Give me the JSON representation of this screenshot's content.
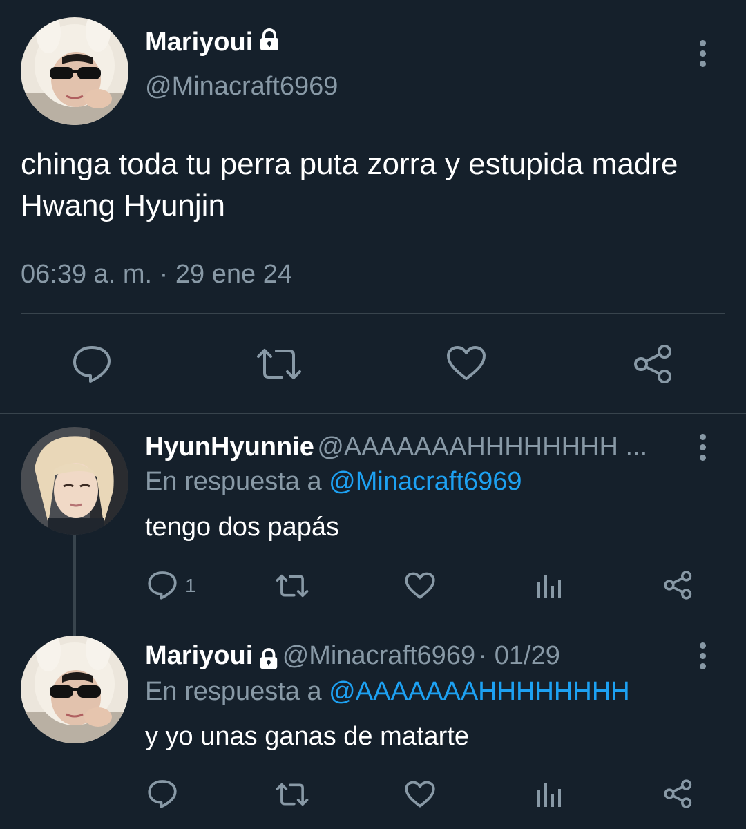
{
  "colors": {
    "background": "#15202b",
    "text_primary": "#ffffff",
    "text_secondary": "#8899a6",
    "link": "#1da1f2",
    "divider": "#38444d"
  },
  "main_tweet": {
    "author_name": "Mariyoui",
    "author_handle": "@Minacraft6969",
    "text": "chinga toda tu perra puta zorra y estupida madre Hwang Hyunjin",
    "time": "06:39 a. m.",
    "date": "29 ene 24",
    "icons": [
      "reply-icon",
      "retweet-icon",
      "like-icon",
      "share-icon"
    ]
  },
  "replies": [
    {
      "author_name": "HyunHyunnie",
      "author_handle": "@AAAAAAAHHHHHHHH ...",
      "reply_prefix": "En respuesta a",
      "reply_to": "@Minacraft6969",
      "text": "tengo dos papás",
      "reply_count": "1"
    },
    {
      "author_name": "Mariyoui",
      "author_handle": "@Minacraft6969",
      "date": "· 01/29",
      "reply_prefix": "En respuesta a",
      "reply_to": "@AAAAAAAHHHHHHHH",
      "text": "y yo unas ganas de matarte"
    }
  ]
}
